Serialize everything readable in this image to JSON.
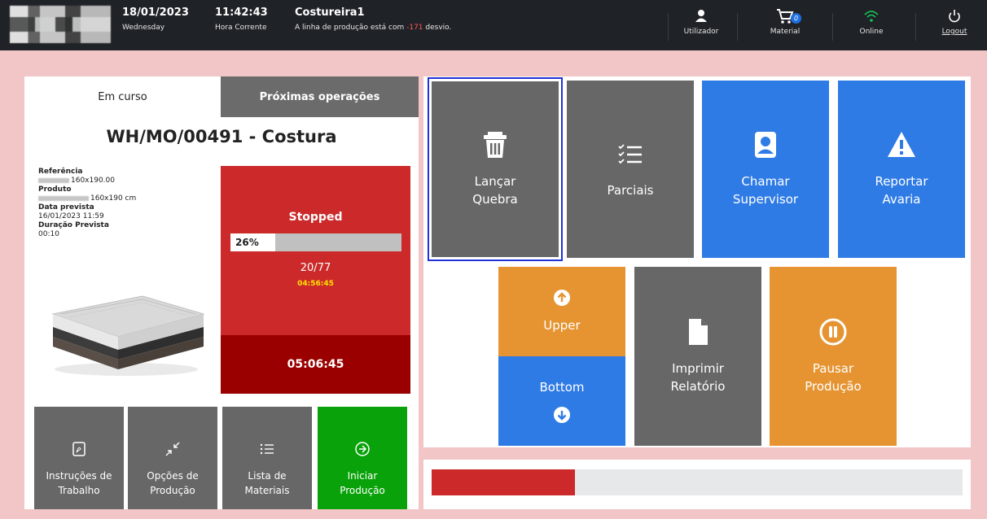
{
  "header": {
    "date": "18/01/2023",
    "weekday": "Wednesday",
    "time": "11:42:43",
    "time_label": "Hora Corrente",
    "station": "Costureira1",
    "message_prefix": "A linha de produção está com ",
    "desvio_value": "-171",
    "message_suffix": " desvio.",
    "user_label": "Utilizador",
    "material_label": "Material",
    "material_count": "0",
    "online_label": "Online",
    "logout_label": "Logout"
  },
  "tabs": {
    "current": "Em curso",
    "next": "Próximas operações"
  },
  "order": {
    "title": "WH/MO/00491 - Costura",
    "referencia_label": "Referência",
    "referencia_value": "160x190.00",
    "produto_label": "Produto",
    "produto_value": "160x190 cm",
    "data_label": "Data prevista",
    "data_value": "16/01/2023 11:59",
    "duracao_label": "Duração Prevista",
    "duracao_value": "00:10"
  },
  "status": {
    "state": "Stopped",
    "progress_label": "26%",
    "progress": 0.26,
    "quantity": "20/77",
    "elapsed": "04:56:45",
    "total": "05:06:45"
  },
  "left_buttons": [
    {
      "line1": "Instruções de",
      "line2": "Trabalho",
      "icon": "pdf-icon"
    },
    {
      "line1": "Opções de",
      "line2": "Produção",
      "icon": "collapse-arrows-icon"
    },
    {
      "line1": "Lista de",
      "line2": "Materiais",
      "icon": "list-icon"
    },
    {
      "line1": "Iniciar",
      "line2": "Produção",
      "icon": "arrow-circle-right-icon"
    }
  ],
  "action_buttons": {
    "lancar_quebra": {
      "line1": "Lançar",
      "line2": "Quebra",
      "icon": "trash-icon"
    },
    "parciais": {
      "line1": "Parciais",
      "icon": "checklist-icon"
    },
    "chamar_supervisor": {
      "line1": "Chamar",
      "line2": "Supervisor",
      "icon": "person-badge-icon"
    },
    "reportar_avaria": {
      "line1": "Reportar",
      "line2": "Avaria",
      "icon": "warning-icon"
    },
    "upper": {
      "label": "Upper",
      "icon": "arrow-up-circle-icon"
    },
    "bottom": {
      "label": "Bottom",
      "icon": "arrow-down-circle-icon"
    },
    "imprimir": {
      "line1": "Imprimir",
      "line2": "Relatório",
      "icon": "document-icon"
    },
    "pausar": {
      "line1": "Pausar",
      "line2": "Produção",
      "icon": "pause-circle-icon"
    }
  },
  "footer_progress": 0.27,
  "colors": {
    "topbar": "#1f2226",
    "background": "#f2c6c6",
    "red": "#cc2a2a",
    "dark_red": "#9b0000",
    "gray": "#676767",
    "blue": "#2f7be5",
    "orange": "#e69432",
    "green": "#0aa20a",
    "wifi": "#19c35a"
  }
}
